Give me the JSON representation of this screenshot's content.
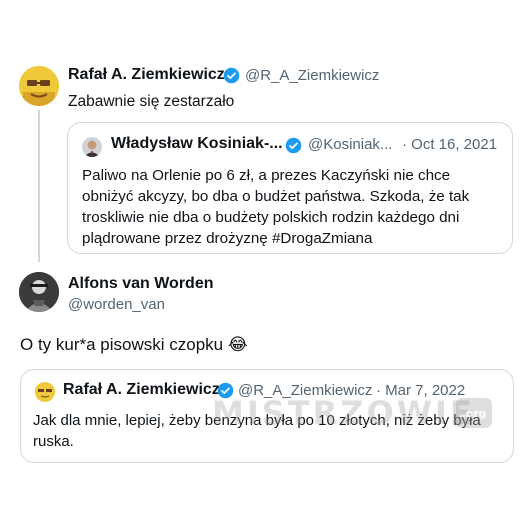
{
  "main_tweet": {
    "author_name": "Rafał A. Ziemkiewicz",
    "handle": "@R_A_Ziemkiewicz",
    "text": "Zabawnie się zestarzało",
    "quoted": {
      "author_name": "Władysław Kosiniak-...",
      "handle": "@Kosiniak...",
      "date": "· Oct 16, 2021",
      "text_lines": [
        "Paliwo na Orlenie po 6 zł, a prezes Kaczyński nie chce",
        "obniżyć akcyzy, bo dba o budżet państwa. Szkoda, że tak",
        "troskliwie nie dba o budżety polskich rodzin każdego dni",
        "plądrowane przez drożyznę #DrogaZmiana"
      ]
    }
  },
  "reply_tweet": {
    "author_name": "Alfons van Worden",
    "handle": "@worden_van",
    "text": "O ty kur*a pisowski czopku",
    "emoji": "😂",
    "quoted": {
      "author_name": "Rafał A. Ziemkiewicz",
      "handle": "@R_A_Ziemkiewicz",
      "date": "· Mar 7, 2022",
      "text_lines": [
        "Jak dla mnie, lepiej, żeby benzyna była po 10 złotych, niż żeby była",
        "ruska."
      ]
    }
  },
  "watermark": {
    "text": "MISTRZOWIE",
    "badge": ".org"
  },
  "colors": {
    "verified_blue": "#1d9bf0",
    "handle_gray": "#536471",
    "border": "#cfd9de"
  }
}
